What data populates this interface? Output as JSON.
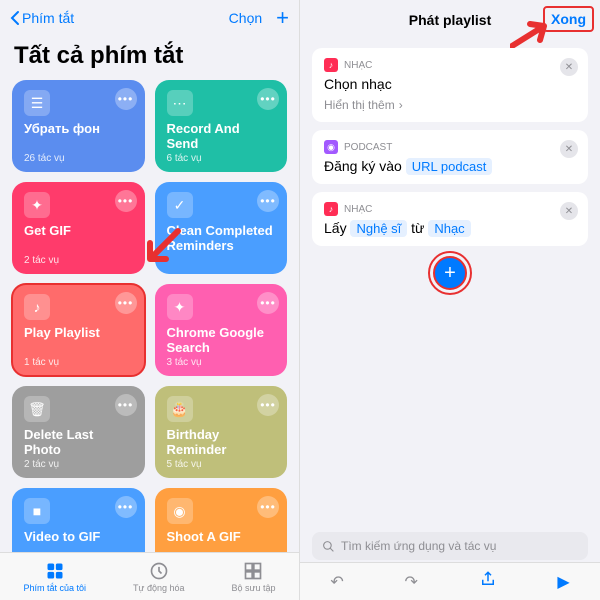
{
  "left": {
    "back": "Phím tắt",
    "choose": "Chọn",
    "title": "Tất cả phím tắt",
    "cards": [
      {
        "name": "Убрать фон",
        "sub": "26 tác vụ",
        "color": "#5b8def",
        "icon": "layers"
      },
      {
        "name": "Record And Send",
        "sub": "6 tác vụ",
        "color": "#1fbfa6",
        "icon": "dots"
      },
      {
        "name": "Get GIF",
        "sub": "2 tác vụ",
        "color": "#ff3b6b",
        "icon": "wand"
      },
      {
        "name": "Clean Completed Reminders",
        "sub": "",
        "color": "#4a9eff",
        "icon": "check"
      },
      {
        "name": "Play Playlist",
        "sub": "1 tác vụ",
        "color": "#ff6b6b",
        "icon": "music",
        "hl": true
      },
      {
        "name": "Chrome Google Search",
        "sub": "3 tác vụ",
        "color": "#ff5fb0",
        "icon": "wand"
      },
      {
        "name": "Delete Last Photo",
        "sub": "2 tác vụ",
        "color": "#9e9e9e",
        "icon": "trash"
      },
      {
        "name": "Birthday Reminder",
        "sub": "5 tác vụ",
        "color": "#bfbf7a",
        "icon": "cake"
      },
      {
        "name": "Video to GIF",
        "sub": "",
        "color": "#4a9eff",
        "icon": "video"
      },
      {
        "name": "Shoot A GIF",
        "sub": "",
        "color": "#ff9f40",
        "icon": "camera"
      }
    ],
    "tabs": [
      "Phím tắt của tôi",
      "Tự động hóa",
      "Bộ sưu tập"
    ]
  },
  "right": {
    "title": "Phát playlist",
    "done": "Xong",
    "box1": {
      "app": "NHẠC",
      "text": "Chọn nhạc",
      "more": "Hiển thị thêm"
    },
    "box2": {
      "app": "PODCAST",
      "text": "Đăng ký vào",
      "chip": "URL podcast"
    },
    "box3": {
      "app": "NHẠC",
      "text": "Lấy",
      "chip1": "Nghệ sĩ",
      "mid": "từ",
      "chip2": "Nhạc"
    },
    "search": "Tìm kiếm ứng dụng và tác vụ"
  }
}
